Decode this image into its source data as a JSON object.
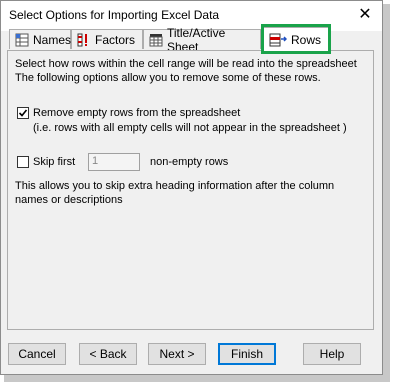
{
  "window": {
    "title": "Select Options for Importing Excel Data",
    "close_glyph": "✕"
  },
  "tabs": [
    {
      "label": "Names",
      "icon": "names-table-icon"
    },
    {
      "label": "Factors",
      "icon": "factors-icon"
    },
    {
      "label": "Title/Active Sheet",
      "icon": "title-sheet-icon"
    },
    {
      "label": "Rows",
      "icon": "rows-icon",
      "active": true
    }
  ],
  "rows_tab": {
    "intro_line1": "Select how rows within the cell range will be read into the spreadsheet",
    "intro_line2": "The following options allow you to remove some of these rows.",
    "remove_empty_label": "Remove empty rows from the spreadsheet",
    "remove_empty_checked": true,
    "remove_empty_note": "(i.e. rows with all empty cells will not appear in the spreadsheet )",
    "skip_first_label": "Skip first",
    "skip_first_checked": false,
    "skip_first_value": "1",
    "skip_suffix": "non-empty rows",
    "skip_help_line1": "This allows you to skip extra heading information after the column",
    "skip_help_line2": "names or descriptions"
  },
  "buttons": {
    "cancel": "Cancel",
    "back": "< Back",
    "next": "Next >",
    "finish": "Finish",
    "help": "Help"
  },
  "colors": {
    "highlight": "#1aa34a",
    "default_button_border": "#0078d7"
  }
}
